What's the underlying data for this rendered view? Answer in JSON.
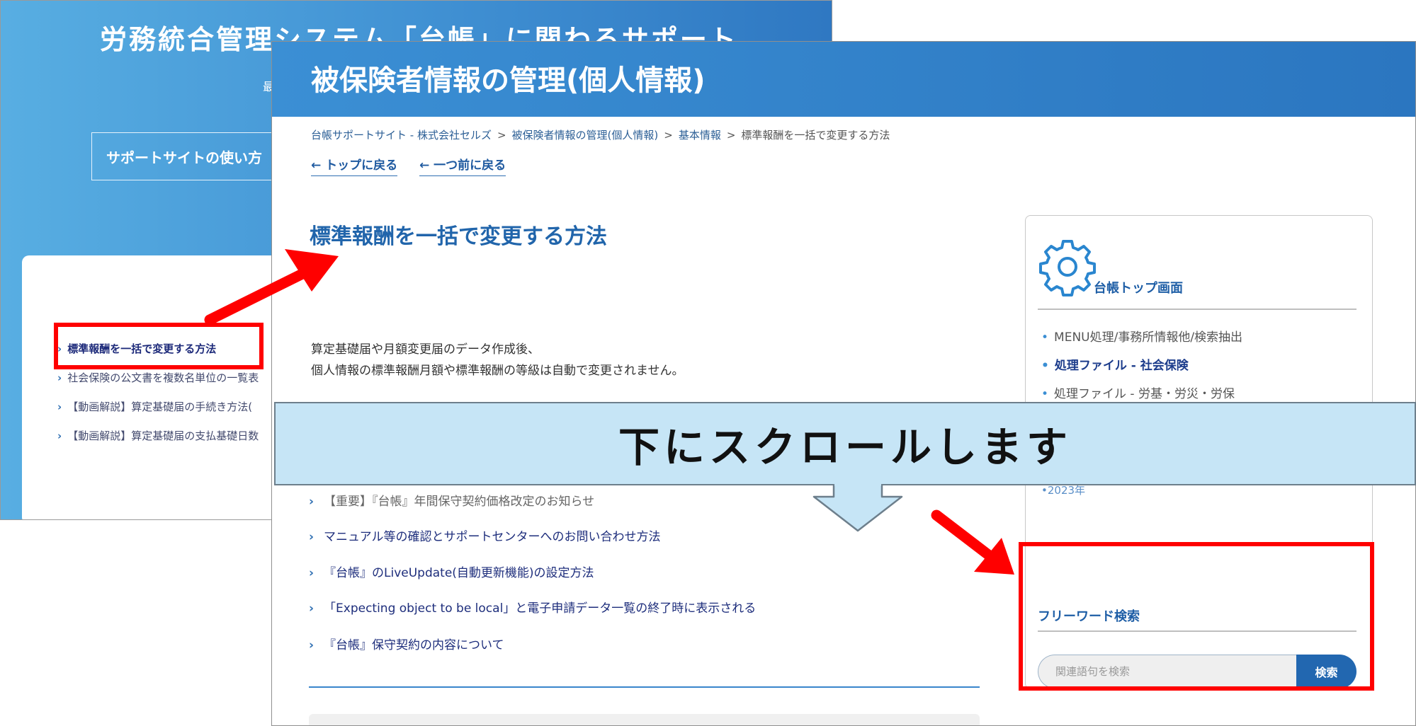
{
  "back_page": {
    "title": "労務統合管理システム「台帳」に関わるサポート",
    "subtitle": "最",
    "usage_button": "サポートサイトの使い方",
    "items": [
      "標準報酬を一括で変更する方法",
      "社会保険の公文書を複数名単位の一覧表",
      "【動画解説】算定基礎届の手続き方法(",
      "【動画解説】算定基礎届の支払基礎日数"
    ]
  },
  "front_page": {
    "title": "被保険者情報の管理(個人情報)",
    "breadcrumb": [
      "台帳サポートサイト - 株式会社セルズ",
      "被保険者情報の管理(個人情報)",
      "基本情報",
      "標準報酬を一括で変更する方法"
    ],
    "breadcrumb_separator": ">",
    "nav": {
      "top": "← トップに戻る",
      "back": "← 一つ前に戻る"
    },
    "article_title": "標準報酬を一括で変更する方法",
    "body_lines": [
      "算定基礎届や月額変更届のデータ作成後、",
      "個人情報の標準報酬月額や標準報酬の等級は自動で変更されません。"
    ],
    "related": [
      "【重要】『台帳』年間保守契約価格改定のお知らせ",
      "マニュアル等の確認とサポートセンターへのお問い合わせ方法",
      "『台帳』のLiveUpdate(自動更新機能)の設定方法",
      "「Expecting object to be local」と電子申請データ一覧の終了時に表示される",
      "『台帳』保守契約の内容について"
    ],
    "sidebar": {
      "top_label": "台帳トップ画面",
      "items": [
        "MENU処理/事務所情報他/検索抽出",
        "処理ファイル - 社会保険",
        "処理ファイル - 労基・労災・労保"
      ],
      "year_item": "2023年",
      "free_search_label": "フリーワード検索",
      "search_placeholder": "関連語句を検索",
      "search_button": "検索"
    }
  },
  "annotation": {
    "scroll_text": "下にスクロールします",
    "highlight_color": "#ff0000",
    "callout_color": "#c6e5f6"
  }
}
